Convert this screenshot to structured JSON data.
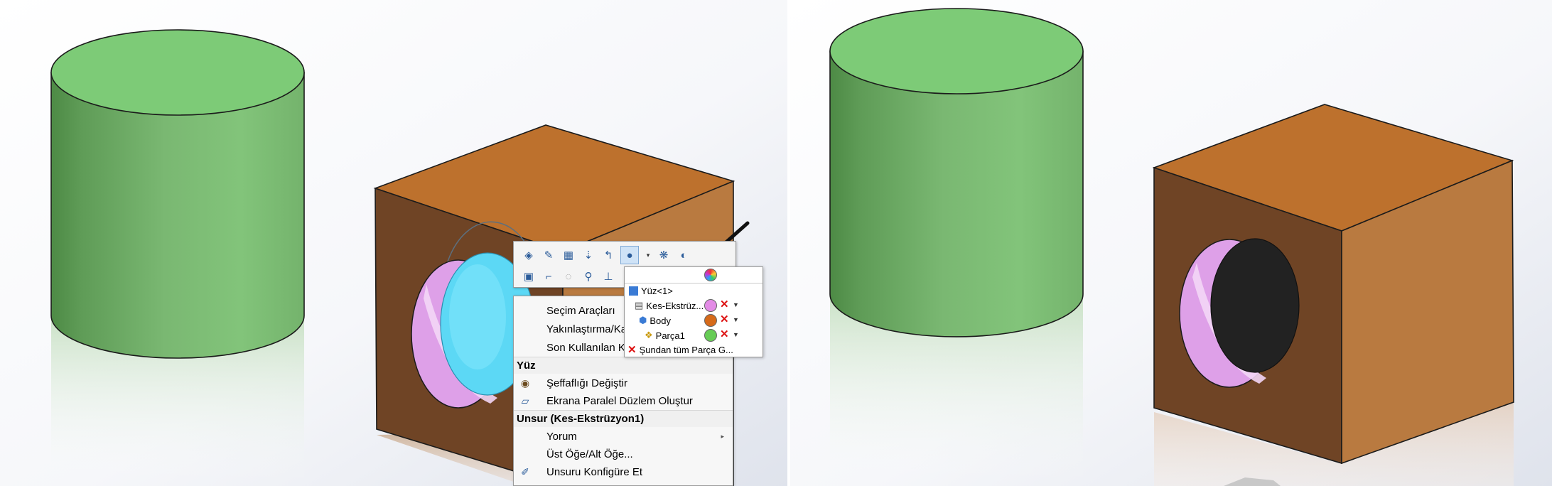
{
  "context_toolbar": {
    "icons": [
      "zoom-to-selection-icon",
      "edit-sketch-icon",
      "edit-feature-icon",
      "normal-to-icon",
      "rollback-icon",
      "appearance-icon",
      "hide-component-icon",
      "isolate-icon",
      "section-view-icon",
      "sketch-icon",
      "hide-icon",
      "zoom-icon",
      "measure-icon"
    ]
  },
  "context_menu": {
    "items": {
      "selection_tools": "Seçim Araçları",
      "zoom_pan": "Yakınlaştırma/Ka",
      "recent_commands": "Son Kullanılan K",
      "face_header": "Yüz",
      "change_transparency": "Şeffaflığı Değiştir",
      "create_plane": "Ekrana Paralel Düzlem Oluştur",
      "feature_header": "Unsur (Kes-Ekstrüzyon1)",
      "comment": "Yorum",
      "parent_child": "Üst Öğe/Alt Öğe...",
      "configure_feature": "Unsuru Konfigüre Et"
    }
  },
  "appearance_callout": {
    "face_label": "Yüz<1>",
    "feature_label": "Kes-Ekstrüz...",
    "body_label": "Body",
    "part_label": "Parça1",
    "remove_all_label": "Şundan tüm Parça G...",
    "colors": {
      "feature": "#e38ce6",
      "body": "#d66a1a",
      "part": "#66cc55"
    }
  },
  "colors": {
    "cylinder_side": "#72b26a",
    "cylinder_top": "#7dcb77",
    "box_top": "#bd712d",
    "box_front": "#6f4425",
    "box_right": "#b97a40",
    "hole_inner": "#df9de8",
    "selected_face": "#5cd8f5",
    "hole_back_dark": "#222222"
  }
}
